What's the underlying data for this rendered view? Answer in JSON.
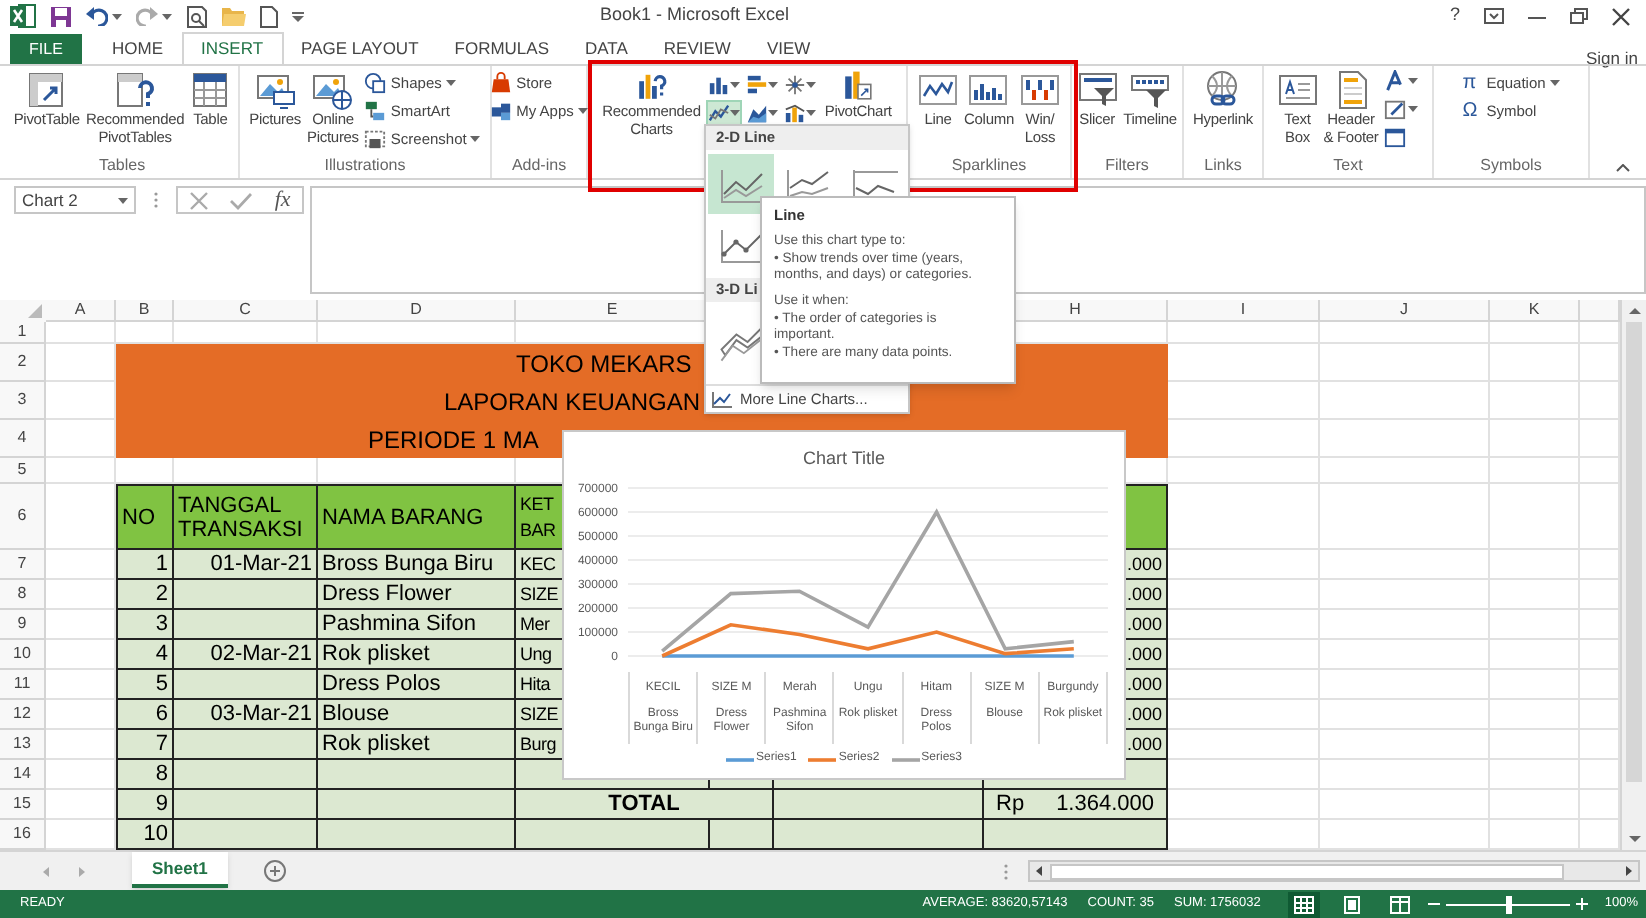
{
  "window": {
    "title": "Book1 - Microsoft Excel",
    "help": "?"
  },
  "tabs": [
    {
      "label": "FILE",
      "kind": "file",
      "selected": false
    },
    {
      "label": "HOME",
      "kind": "tab",
      "selected": false
    },
    {
      "label": "INSERT",
      "kind": "tab",
      "selected": true
    },
    {
      "label": "PAGE LAYOUT",
      "kind": "tab",
      "selected": false
    },
    {
      "label": "FORMULAS",
      "kind": "tab",
      "selected": false
    },
    {
      "label": "DATA",
      "kind": "tab",
      "selected": false
    },
    {
      "label": "REVIEW",
      "kind": "tab",
      "selected": false
    },
    {
      "label": "VIEW",
      "kind": "tab",
      "selected": false
    }
  ],
  "sign_in": "Sign in",
  "ribbon": [
    {
      "label": "Tables",
      "items": [
        {
          "kind": "large",
          "label": "PivotTable"
        },
        {
          "kind": "large",
          "label": "Recommended\nPivotTables"
        },
        {
          "kind": "large",
          "label": "Table"
        }
      ]
    },
    {
      "label": "Illustrations",
      "items": [
        {
          "kind": "large",
          "label": "Pictures"
        },
        {
          "kind": "large",
          "label": "Online\nPictures"
        },
        {
          "kind": "stack",
          "items": [
            {
              "label": "Shapes",
              "dropdown": true
            },
            {
              "label": "SmartArt",
              "dropdown": false
            },
            {
              "label": "Screenshot",
              "dropdown": true
            }
          ]
        }
      ]
    },
    {
      "label": "Add-ins",
      "items": [
        {
          "kind": "stack",
          "items": [
            {
              "label": "Store",
              "dropdown": false
            },
            {
              "label": "My Apps",
              "dropdown": true
            }
          ]
        }
      ]
    },
    {
      "items": [
        {
          "kind": "large",
          "label": "Recommended\nCharts"
        },
        {
          "kind": "grid",
          "items": [
            {
              "selected": false
            },
            {
              "selected": false
            },
            {
              "selected": false
            },
            {
              "selected": true
            },
            {
              "selected": false
            },
            {
              "selected": false
            }
          ]
        },
        {
          "kind": "large",
          "label": "PivotChart"
        }
      ]
    },
    {
      "label": "Sparklines",
      "items": [
        {
          "kind": "large",
          "label": "Line"
        },
        {
          "kind": "large",
          "label": "Column"
        },
        {
          "kind": "large",
          "label": "Win/\nLoss"
        }
      ]
    },
    {
      "label": "Filters",
      "items": [
        {
          "kind": "large",
          "label": "Slicer"
        },
        {
          "kind": "large",
          "label": "Timeline"
        }
      ]
    },
    {
      "label": "Links",
      "items": [
        {
          "kind": "large",
          "label": "Hyperlink"
        }
      ]
    },
    {
      "label": "Text",
      "items": [
        {
          "kind": "large",
          "label": "Text\nBox"
        },
        {
          "kind": "large",
          "label": "Header\n& Footer"
        },
        {
          "kind": "icons",
          "items": [
            {
              "dropdown": true
            },
            {
              "dropdown": true
            },
            {
              "dropdown": false
            }
          ]
        }
      ]
    },
    {
      "label": "Symbols",
      "items": [
        {
          "kind": "stack",
          "items": [
            {
              "glyph": "π",
              "label": "Equation",
              "dropdown": true
            },
            {
              "glyph": "Ω",
              "label": "Symbol",
              "dropdown": false
            }
          ]
        }
      ]
    }
  ],
  "formula_bar": {
    "name_box": "Chart 2",
    "function_label": "fx"
  },
  "sheet": {
    "columns": [
      {
        "label": "A"
      },
      {
        "label": "B"
      },
      {
        "label": "C"
      },
      {
        "label": "D"
      },
      {
        "label": "E"
      },
      {},
      {},
      {
        "label": "H"
      },
      {
        "label": "I"
      },
      {
        "label": "J"
      },
      {
        "label": "K"
      },
      {}
    ],
    "rows": [
      {
        "number": "1",
        "kind": "blank"
      },
      {
        "number": "2",
        "kind": "title",
        "text": "TOKO MEKARS"
      },
      {
        "number": "3",
        "kind": "title",
        "text": "LAPORAN KEUANGAN"
      },
      {
        "number": "4",
        "kind": "title",
        "text": "PERIODE 1 MA"
      },
      {
        "number": "5",
        "kind": "blank"
      },
      {
        "number": "6",
        "kind": "header",
        "cells": {
          "b": "NO",
          "c": "TANGGAL TRANSAKSI",
          "d": "NAMA BARANG",
          "e": "KET BAR"
        }
      },
      {
        "number": "7",
        "kind": "data",
        "cells": {
          "b": "1",
          "c": "01-Mar-21",
          "d": "Bross Bunga Biru",
          "e": "KEC",
          "h": ".000"
        }
      },
      {
        "number": "8",
        "kind": "data",
        "cells": {
          "b": "2",
          "d": "Dress Flower",
          "e": "SIZE",
          "h": ".000"
        }
      },
      {
        "number": "9",
        "kind": "data",
        "cells": {
          "b": "3",
          "d": "Pashmina Sifon",
          "e": "Mer",
          "h": ".000"
        }
      },
      {
        "number": "10",
        "kind": "data",
        "cells": {
          "b": "4",
          "c": "02-Mar-21",
          "d": "Rok plisket",
          "e": "Ung",
          "h": ".000"
        }
      },
      {
        "number": "11",
        "kind": "data",
        "cells": {
          "b": "5",
          "d": "Dress Polos",
          "e": "Hita",
          "h": ".000"
        }
      },
      {
        "number": "12",
        "kind": "data",
        "cells": {
          "b": "6",
          "c": "03-Mar-21",
          "d": "Blouse",
          "e": "SIZE",
          "h": ".000"
        }
      },
      {
        "number": "13",
        "kind": "data",
        "cells": {
          "b": "7",
          "d": "Rok plisket",
          "e": "Burg",
          "h": ".000"
        }
      },
      {
        "number": "14",
        "kind": "data",
        "cells": {
          "b": "8"
        }
      },
      {
        "number": "15",
        "kind": "total",
        "cells": {
          "b": "9",
          "e": "TOTAL",
          "h_prefix": "Rp",
          "h": "1.364.000"
        }
      },
      {
        "number": "16",
        "kind": "data",
        "cells": {
          "b": "10"
        }
      }
    ]
  },
  "chart": {
    "chart_data": {
      "type": "line",
      "title": "Chart Title",
      "categories": [
        "KECIL\nBross Bunga Biru",
        "SIZE M\nDress Flower",
        "Merah\nPashmina Sifon",
        "Ungu\nRok plisket",
        "Hitam\nDress Polos",
        "SIZE M\nBlouse",
        "Burgundy\nRok plisket"
      ],
      "grid": true,
      "legend": true,
      "series": [
        {
          "name": "Series1",
          "color": "#5b9bd5",
          "values": [
            0,
            0,
            0,
            0,
            0,
            0,
            0
          ]
        },
        {
          "name": "Series2",
          "color": "#ed7d31",
          "values": [
            0,
            130000,
            90000,
            30000,
            100000,
            10000,
            30000
          ]
        },
        {
          "name": "Series3",
          "color": "#a5a5a5",
          "values": [
            20000,
            260000,
            270000,
            120000,
            600000,
            30000,
            60000
          ]
        }
      ],
      "ylim": [
        0,
        700000
      ],
      "yticks": [
        0,
        100000,
        200000,
        300000,
        400000,
        500000,
        600000,
        700000
      ]
    }
  },
  "line_menu": {
    "sections": [
      {
        "title": "2-D Line",
        "options": [
          {
            "selected": true
          },
          {
            "selected": false
          },
          {
            "selected": false
          },
          {
            "selected": false
          }
        ]
      },
      {
        "title": "3-D Li",
        "options": [
          {
            "selected": false
          }
        ]
      }
    ],
    "more": "More Line Charts..."
  },
  "tooltip": {
    "title": "Line",
    "sections": [
      [
        "Use this chart type to:",
        "• Show trends over time (years, months, and days) or categories."
      ],
      [
        "Use it when:",
        "• The order of categories is important.",
        "• There are many data points."
      ]
    ]
  },
  "sheet_tabs": [
    {
      "label": "Sheet1",
      "selected": true
    }
  ],
  "status_bar": {
    "mode": "READY",
    "average": "AVERAGE: 83620,57143",
    "count": "COUNT: 35",
    "sum": "SUM: 1756032",
    "views": [
      {
        "selected": true
      },
      {
        "selected": false
      },
      {
        "selected": false
      }
    ],
    "zoom_slider": {
      "level": 0.5
    },
    "zoom": "100%"
  }
}
